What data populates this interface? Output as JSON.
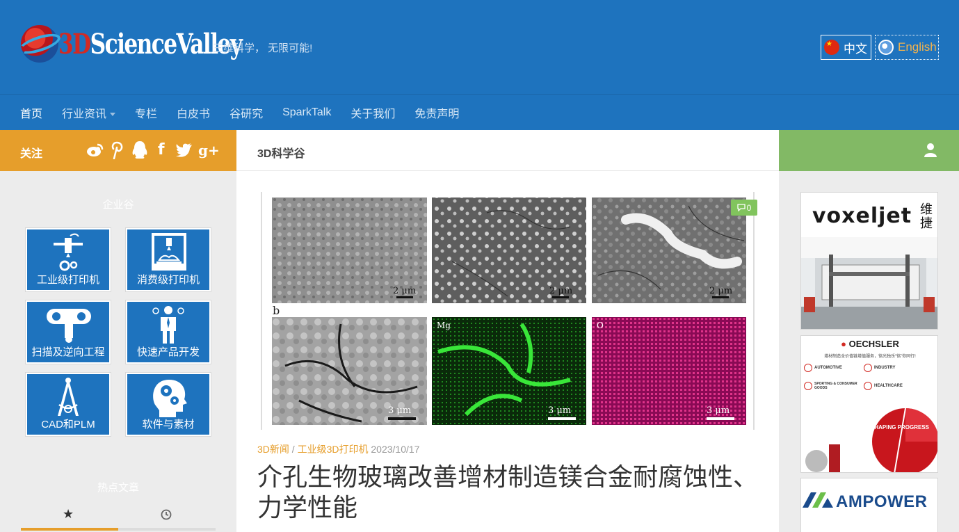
{
  "header": {
    "logo_text_red": "3D",
    "logo_text": "ScienceValley",
    "tagline": "三维科学， 无限可能!",
    "lang_zh": "中文",
    "lang_en": "English"
  },
  "nav": {
    "items": [
      "首页",
      "行业资讯",
      "专栏",
      "白皮书",
      "谷研究",
      "SparkTalk",
      "关于我们",
      "免责声明"
    ]
  },
  "sidebar": {
    "follow_label": "关注",
    "social_icons": [
      "weibo-icon",
      "pinterest-icon",
      "qq-icon",
      "facebook-icon",
      "twitter-icon",
      "google-plus-icon"
    ],
    "section1_title": "企业谷",
    "tiles": [
      {
        "label": "工业级打印机",
        "icon": "industrial-printer-icon"
      },
      {
        "label": "消费级打印机",
        "icon": "desktop-printer-icon"
      },
      {
        "label": "扫描及逆向工程",
        "icon": "scanner-icon"
      },
      {
        "label": "快速产品开发",
        "icon": "businessman-icon"
      },
      {
        "label": "CAD和PLM",
        "icon": "compass-icon"
      },
      {
        "label": "软件与素材",
        "icon": "head-gears-icon"
      }
    ],
    "section2_title": "热点文章",
    "tab_icons": [
      "star-icon",
      "clock-icon"
    ]
  },
  "main": {
    "header": "3D科学谷",
    "comment_count": "0",
    "image_labels": {
      "scale_top": "2 μm",
      "scale_bottom": "3 μm",
      "panel_b": "b",
      "map_mg": "Mg",
      "map_o": "O"
    },
    "meta": {
      "category1": "3D新闻",
      "separator": "/",
      "category2": "工业级3D打印机",
      "date": "2023/10/17"
    },
    "title": "介孔生物玻璃改善增材制造镁合金耐腐蚀性、力学性能"
  },
  "right": {
    "user_icon": "user-icon",
    "ads": [
      {
        "brand": "voxeljet",
        "cn": "维捷"
      },
      {
        "brand": "OECHSLER",
        "slogan": "增材制造全价值链增值服务，铭光独乐“铭”你同行!",
        "items": [
          "AUTOMOTIVE",
          "INDUSTRY",
          "SPORTING & CONSUMER GOODS",
          "HEALTHCARE"
        ],
        "tagline": "SHAPING PROGRESS"
      },
      {
        "brand": "AMPOWER"
      }
    ]
  },
  "colors": {
    "header_blue": "#1e73be",
    "follow_orange": "#e69e2b",
    "user_green": "#82b965"
  }
}
